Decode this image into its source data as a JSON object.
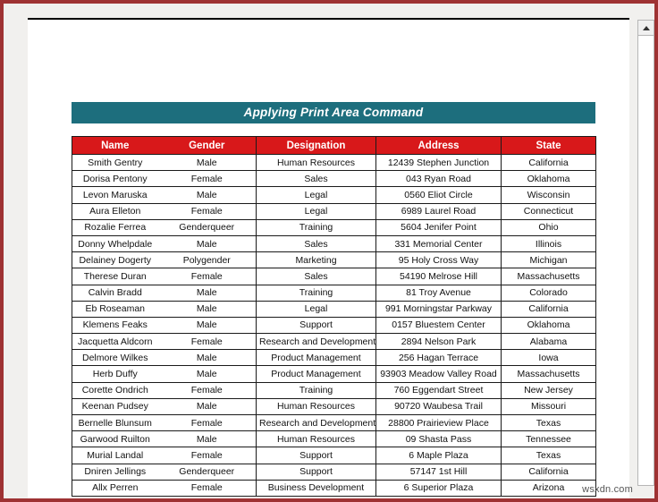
{
  "document": {
    "title_banner": "Applying Print Area Command",
    "watermark": "wsxdn.com"
  },
  "colors": {
    "banner_teal": "#1d6e7d",
    "header_red": "#d8181a",
    "window_border": "#9e3233",
    "page_white": "#ffffff",
    "gutter_gray": "#f1f0ee"
  },
  "table": {
    "columns": [
      "Name",
      "Gender",
      "Designation",
      "Address",
      "State"
    ],
    "rows": [
      [
        "Smith Gentry",
        "Male",
        "Human Resources",
        "12439 Stephen Junction",
        "California"
      ],
      [
        "Dorisa Pentony",
        "Female",
        "Sales",
        "043 Ryan Road",
        "Oklahoma"
      ],
      [
        "Levon Maruska",
        "Male",
        "Legal",
        "0560 Eliot Circle",
        "Wisconsin"
      ],
      [
        "Aura Elleton",
        "Female",
        "Legal",
        "6989 Laurel Road",
        "Connecticut"
      ],
      [
        "Rozalie Ferrea",
        "Genderqueer",
        "Training",
        "5604 Jenifer Point",
        "Ohio"
      ],
      [
        "Donny Whelpdale",
        "Male",
        "Sales",
        "331 Memorial Center",
        "Illinois"
      ],
      [
        "Delainey Dogerty",
        "Polygender",
        "Marketing",
        "95 Holy Cross Way",
        "Michigan"
      ],
      [
        "Therese Duran",
        "Female",
        "Sales",
        "54190 Melrose Hill",
        "Massachusetts"
      ],
      [
        "Calvin Bradd",
        "Male",
        "Training",
        "81 Troy Avenue",
        "Colorado"
      ],
      [
        "Eb Roseaman",
        "Male",
        "Legal",
        "991 Morningstar Parkway",
        "California"
      ],
      [
        "Klemens Feaks",
        "Male",
        "Support",
        "0157 Bluestem Center",
        "Oklahoma"
      ],
      [
        "Jacquetta Aldcorn",
        "Female",
        "Research and Development",
        "2894 Nelson Park",
        "Alabama"
      ],
      [
        "Delmore Wilkes",
        "Male",
        "Product Management",
        "256 Hagan Terrace",
        "Iowa"
      ],
      [
        "Herb Duffy",
        "Male",
        "Product Management",
        "93903 Meadow Valley Road",
        "Massachusetts"
      ],
      [
        "Corette Ondrich",
        "Female",
        "Training",
        "760 Eggendart Street",
        "New Jersey"
      ],
      [
        "Keenan Pudsey",
        "Male",
        "Human Resources",
        "90720 Waubesa Trail",
        "Missouri"
      ],
      [
        "Bernelle Blunsum",
        "Female",
        "Research and Development",
        "28800 Prairieview Place",
        "Texas"
      ],
      [
        "Garwood Ruilton",
        "Male",
        "Human Resources",
        "09 Shasta Pass",
        "Tennessee"
      ],
      [
        "Murial Landal",
        "Female",
        "Support",
        "6 Maple Plaza",
        "Texas"
      ],
      [
        "Dniren Jellings",
        "Genderqueer",
        "Support",
        "57147 1st Hill",
        "California"
      ],
      [
        "Allx Perren",
        "Female",
        "Business Development",
        "6 Superior Plaza",
        "Arizona"
      ]
    ]
  },
  "scrollbar": {
    "up_arrow_icon": "triangle-up-icon"
  }
}
